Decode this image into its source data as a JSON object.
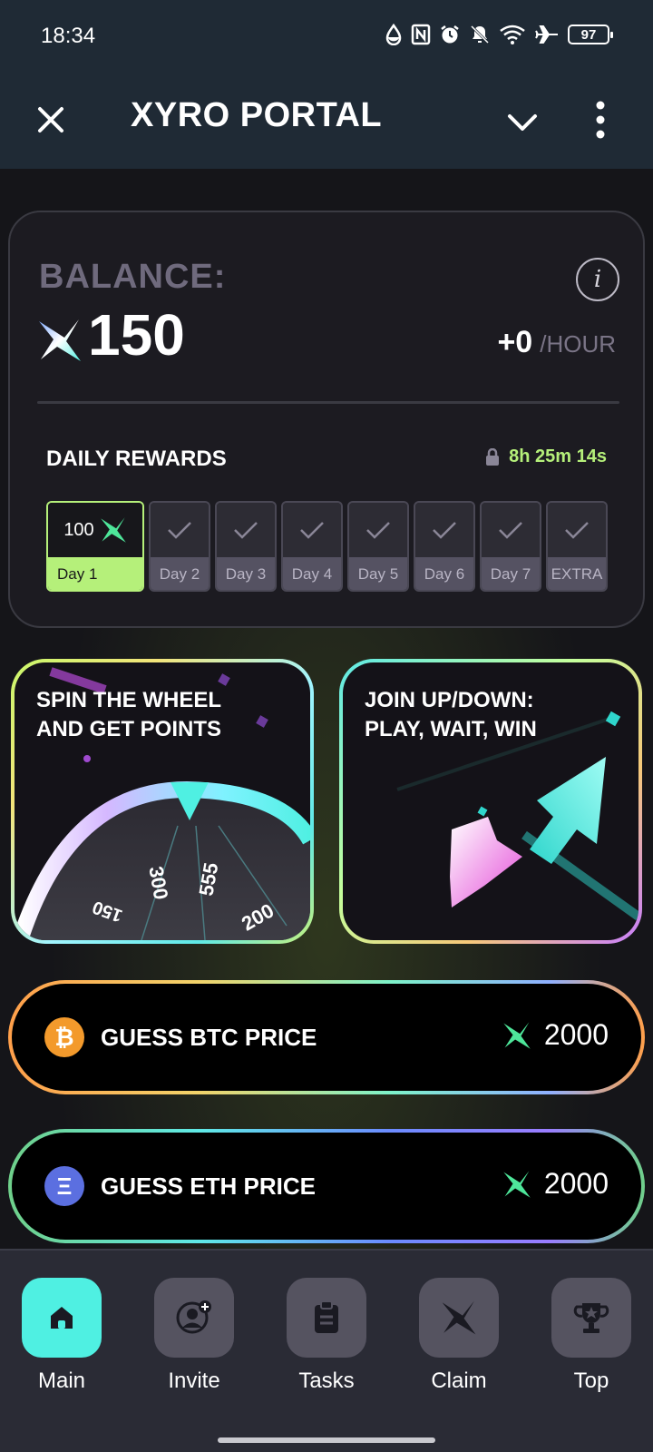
{
  "status_bar": {
    "time": "18:34",
    "battery": "97"
  },
  "header": {
    "title": "XYRO PORTAL"
  },
  "balance": {
    "label": "BALANCE:",
    "info_icon": "i",
    "value": "150",
    "rate_value": "+0",
    "rate_unit": "/HOUR"
  },
  "daily_rewards": {
    "title": "DAILY REWARDS",
    "timer": "8h 25m 14s",
    "days": [
      {
        "amount": "100",
        "label": "Day 1",
        "state": "active"
      },
      {
        "label": "Day 2",
        "state": "locked"
      },
      {
        "label": "Day 3",
        "state": "locked"
      },
      {
        "label": "Day 4",
        "state": "locked"
      },
      {
        "label": "Day 5",
        "state": "locked"
      },
      {
        "label": "Day 6",
        "state": "locked"
      },
      {
        "label": "Day 7",
        "state": "locked"
      },
      {
        "label": "EXTRA",
        "state": "locked"
      }
    ]
  },
  "games": {
    "wheel": {
      "title_line1": "SPIN THE WHEEL",
      "title_line2": "AND GET POINTS",
      "wheel_values": [
        "150",
        "300",
        "555",
        "200"
      ]
    },
    "updown": {
      "title_line1": "JOIN UP/DOWN:",
      "title_line2": "PLAY, WAIT, WIN"
    }
  },
  "guess": [
    {
      "coin": "₿",
      "label": "GUESS BTC PRICE",
      "reward": "2000"
    },
    {
      "coin": "Ξ",
      "label": "GUESS ETH PRICE",
      "reward": "2000"
    }
  ],
  "nav": [
    {
      "label": "Main",
      "icon": "home-icon",
      "active": true
    },
    {
      "label": "Invite",
      "icon": "add-user-icon",
      "active": false
    },
    {
      "label": "Tasks",
      "icon": "clipboard-icon",
      "active": false
    },
    {
      "label": "Claim",
      "icon": "xyro-logo-icon",
      "active": false
    },
    {
      "label": "Top",
      "icon": "trophy-icon",
      "active": false
    }
  ],
  "colors": {
    "accent": "#b5f07a",
    "nav_active": "#4ff0e2",
    "background": "#151519",
    "header": "#1f2a35"
  }
}
